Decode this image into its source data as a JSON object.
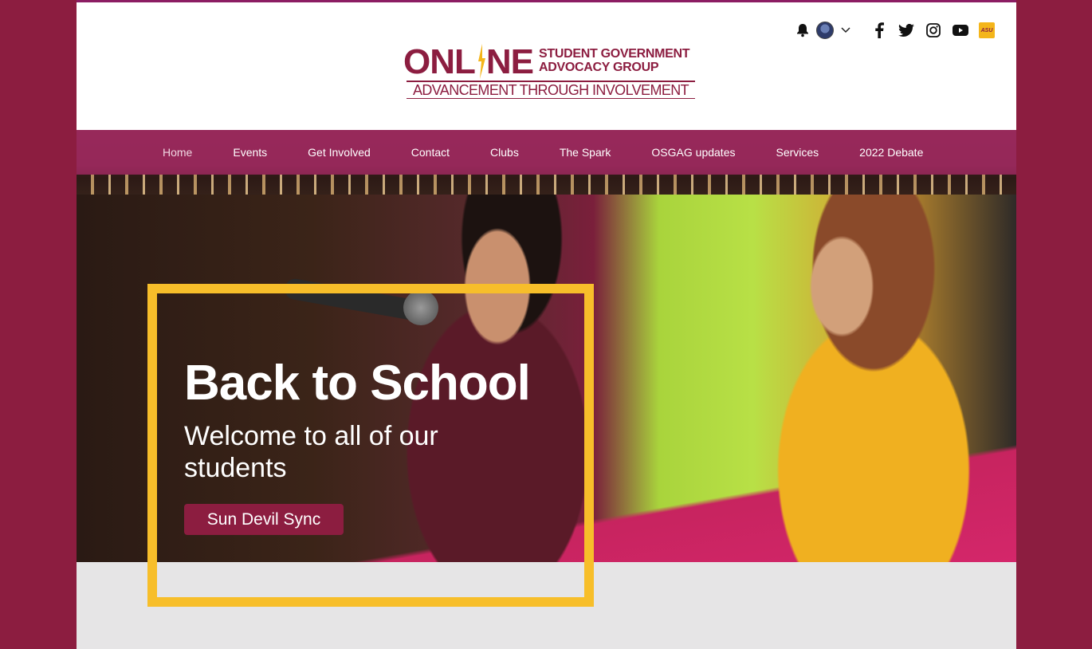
{
  "logo": {
    "main_left": "ONL",
    "main_right": "NE",
    "sub_line1": "STUDENT GOVERNMENT",
    "sub_line2": "ADVOCACY GROUP",
    "tagline": "ADVANCEMENT THROUGH INVOLVEMENT"
  },
  "header_tools": {
    "icons": [
      "bell-icon",
      "avatar",
      "chevron-down-icon",
      "facebook-icon",
      "twitter-icon",
      "instagram-icon",
      "youtube-icon",
      "asu-icon"
    ],
    "asu_label": "ASU"
  },
  "nav": {
    "items": [
      {
        "label": "Home"
      },
      {
        "label": "Events"
      },
      {
        "label": "Get Involved"
      },
      {
        "label": "Contact"
      },
      {
        "label": "Clubs"
      },
      {
        "label": "The Spark"
      },
      {
        "label": "OSGAG updates"
      },
      {
        "label": "Services"
      },
      {
        "label": "2022 Debate"
      }
    ],
    "active": "Home"
  },
  "hero": {
    "title": "Back to School",
    "subtitle": "Welcome to all of our students",
    "cta_label": "Sun Devil Sync"
  },
  "colors": {
    "maroon": "#8c1d40",
    "gold": "#f7be2a",
    "nav_bg": "#962a5a"
  }
}
